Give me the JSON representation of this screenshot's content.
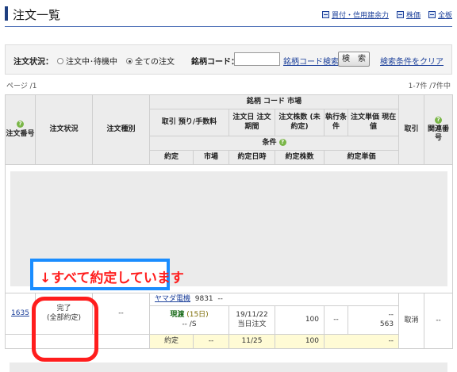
{
  "header": {
    "title": "注文一覧",
    "links": [
      {
        "label": "買付・信用建余力",
        "icon": "calculator-icon"
      },
      {
        "label": "株価",
        "icon": "chart-icon"
      },
      {
        "label": "全板",
        "icon": "board-icon"
      }
    ]
  },
  "filter": {
    "status_label": "注文状況：",
    "option_pending": "注文中･待機中",
    "option_all": "全ての注文",
    "selected": "全ての注文",
    "code_label": "銘柄コード：",
    "code_value": "",
    "code_search_link": "銘柄コード検索",
    "search_button": "検　索",
    "clear_link": "検索条件をクリア"
  },
  "paging": {
    "page": "ページ /1",
    "count": "1-7件 /7件中"
  },
  "table": {
    "headers": {
      "order_no": "注文番号",
      "status": "注文状況",
      "type": "注文種別",
      "stock": "銘柄 コード 市場",
      "trade_fee": "取引 預り/手数料",
      "order_date": "注文日 注文期間",
      "qty": "注文株数 (未約定)",
      "exec_cond": "執行条件",
      "price": "注文単価 現在値",
      "condition": "条件",
      "fill_label": "約定",
      "market": "市場",
      "fill_datetime": "約定日時",
      "fill_qty": "約定株数",
      "fill_price": "約定単価",
      "trade": "取引",
      "related_no": "関連番号"
    },
    "order": {
      "order_no": "1635",
      "status_line1": "完了",
      "status_line2": "(全部約定)",
      "type": "--",
      "stock_name": "ヤマダ電機",
      "stock_code": "9831",
      "stock_market": "--",
      "trade": "現渡",
      "trade_days": "(15日)",
      "fee": "-- /S",
      "order_date": "19/11/22",
      "order_period": "当日注文",
      "qty": "100",
      "exec_cond": "--",
      "price_top": "--",
      "price_current": "563",
      "action": "取消",
      "related": "--",
      "fill_label": "約定",
      "fill_market": "--",
      "fill_date": "11/25",
      "fill_qty": "100",
      "fill_price": "--"
    }
  },
  "annotations": {
    "callout": "↓すべて約定しています"
  }
}
